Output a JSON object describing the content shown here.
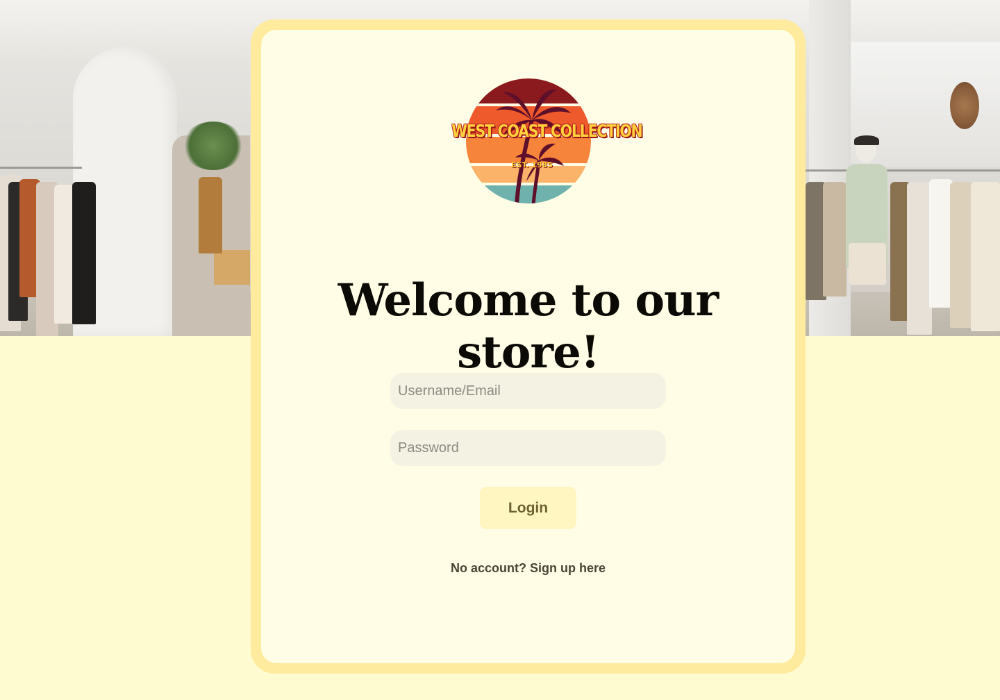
{
  "logo": {
    "name": "WEST COAST COLLECTION",
    "established": "EST. 1985",
    "colors": [
      "#8a1a1e",
      "#ee5a2b",
      "#f6843b",
      "#fbb36a",
      "#6fb2ad",
      "#ffd23d"
    ]
  },
  "heading": "Welcome to our store!",
  "form": {
    "username_placeholder": "Username/Email",
    "password_placeholder": "Password",
    "login_label": "Login",
    "signup_text": "No account? Sign up here"
  },
  "theme": {
    "page_background": "#fffbd0",
    "card_border": "#ffeb9e",
    "card_background": "#fffde6",
    "input_background": "#f4f2e3",
    "button_background": "#fff6c2"
  }
}
